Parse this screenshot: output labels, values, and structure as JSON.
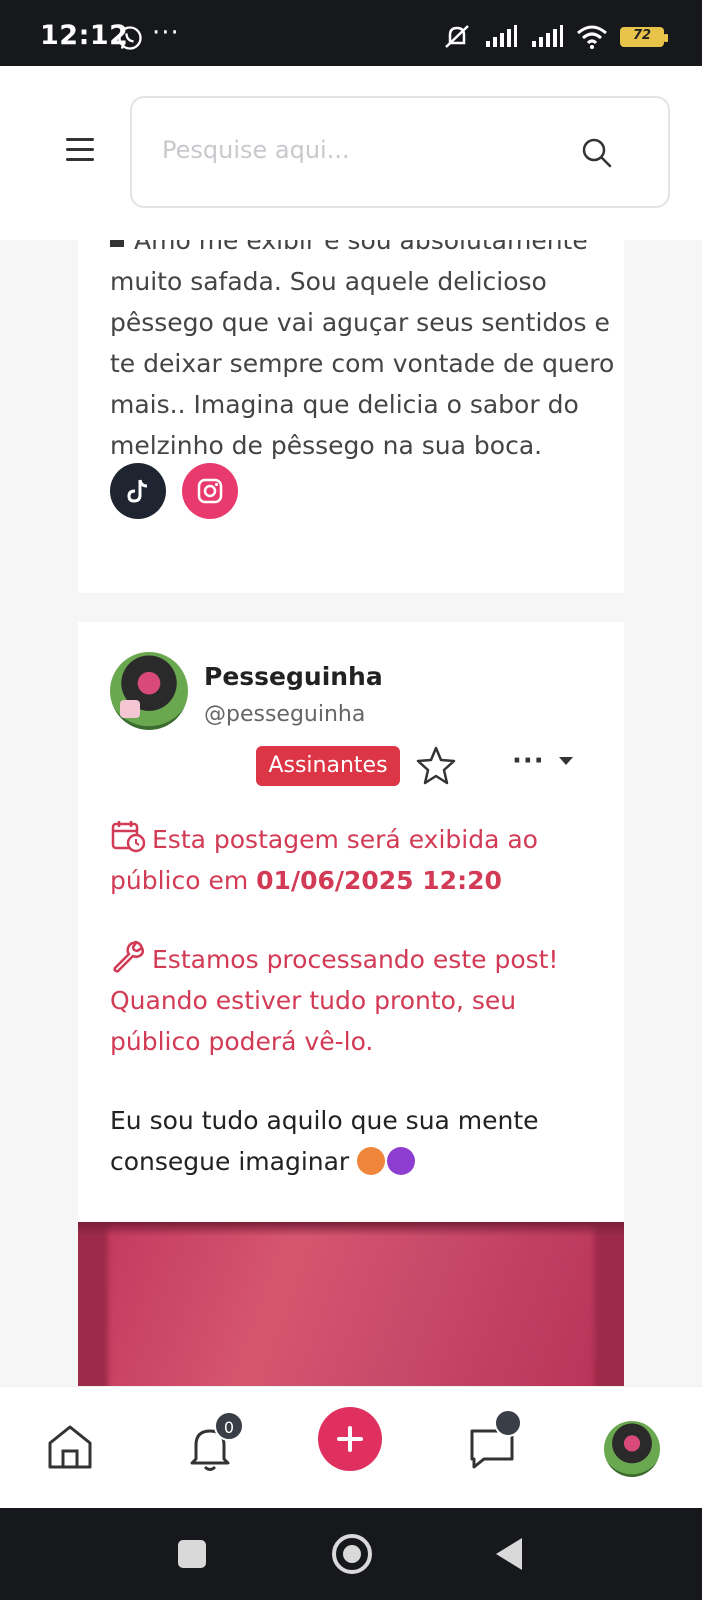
{
  "status_bar": {
    "time": "12:12",
    "overflow": "···",
    "battery_level": "72",
    "icons": [
      "whatsapp-icon",
      "mute-icon",
      "signal-icon",
      "signal-icon",
      "wifi-icon",
      "battery-icon"
    ]
  },
  "header": {
    "menu_icon": "hamburger-icon",
    "search_placeholder": "Pesquise aqui...",
    "search_icon": "search-icon"
  },
  "bio_card": {
    "bio_text": "Amo me exibir e sou absolutamente muito safada. Sou aquele delicioso pêssego que vai aguçar seus sentidos e te deixar sempre com vontade de quero mais.. Imagina que delicia o sabor do melzinho de pêssego na sua boca.",
    "social_icons": [
      "tiktok-icon",
      "instagram-icon"
    ]
  },
  "post": {
    "author_name": "Pesseguinha",
    "author_handle": "@pesseguinha",
    "badge": "Assinantes",
    "more_label": "···",
    "schedule_text": "Esta postagem será exibida ao público em ",
    "schedule_date": "01/06/2025 12:20",
    "processing_text": "Estamos processando este post! Quando estiver tudo pronto, seu público poderá vê-lo.",
    "caption": "Eu sou tudo aquilo que sua mente consegue imaginar",
    "caption_emojis": [
      "hot-face-emoji",
      "smiling-devil-emoji"
    ]
  },
  "bottom_nav": {
    "notifications_count": "0",
    "items": [
      "home-icon",
      "bell-icon",
      "plus-icon",
      "chat-icon",
      "profile-avatar"
    ]
  },
  "colors": {
    "accent": "#e0305f",
    "badge": "#dc3545",
    "notice": "#d23a55",
    "tiktok": "#1e2530",
    "instagram": "#e83a6d"
  }
}
